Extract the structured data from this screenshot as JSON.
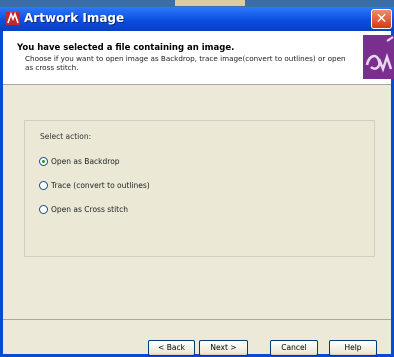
{
  "window": {
    "title": "Artwork Image"
  },
  "header": {
    "title": "You have selected a file containing an image.",
    "description": "Choose if you want to open image as Backdrop, trace image(convert to outlines) or open as cross stitch."
  },
  "options": {
    "label": "Select action:",
    "items": [
      {
        "label": "Open as Backdrop",
        "checked": true
      },
      {
        "label": "Trace (convert to outlines)",
        "checked": false
      },
      {
        "label": "Open as Cross stitch",
        "checked": false
      }
    ]
  },
  "buttons": {
    "back": "< Back",
    "next": "Next >",
    "cancel": "Cancel",
    "help": "Help"
  },
  "colors": {
    "titlebar": "#0a4fe0",
    "radio_selected": "#21a121",
    "logo_purple": "#7a2f8e"
  }
}
